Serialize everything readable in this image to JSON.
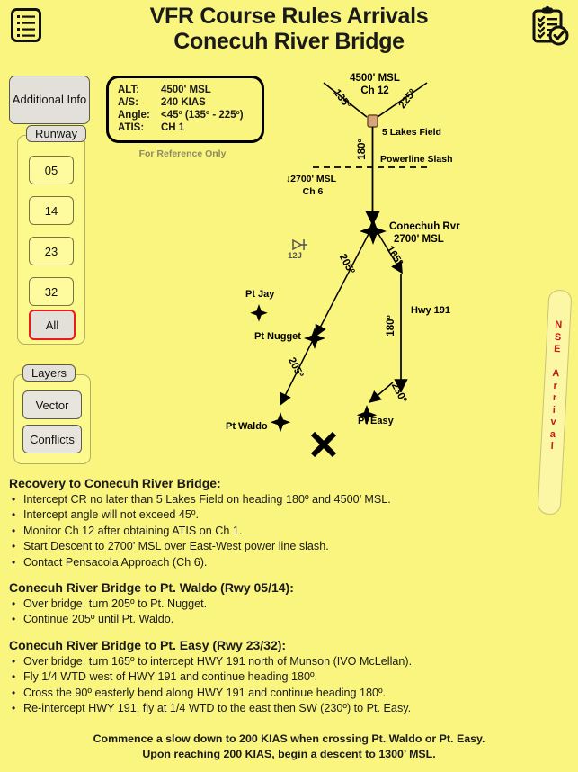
{
  "header": {
    "title_line1": "VFR Course Rules Arrivals",
    "title_line2": "Conecuh River Bridge",
    "notes_icon": "notes-list-icon",
    "checklist_icon": "clipboard-check-icon"
  },
  "controls": {
    "additional_info_label": "Additional Info",
    "runway": {
      "legend": "Runway",
      "buttons": [
        "05",
        "14",
        "23",
        "32",
        "All"
      ],
      "selected": "All",
      "selected_color": "#ee1b1b"
    },
    "layers": {
      "legend": "Layers",
      "buttons": [
        "Vector",
        "Conflicts"
      ]
    }
  },
  "reference_box": {
    "rows": [
      {
        "key": "ALT:",
        "value": "4500' MSL"
      },
      {
        "key": "A/S:",
        "value": "240 KIAS"
      },
      {
        "key": "Angle:",
        "value": "<45º (135º - 225º)"
      },
      {
        "key": "ATIS:",
        "value": "CH 1"
      }
    ],
    "note": "For Reference Only"
  },
  "side_tab": {
    "label": "NSE Arrival",
    "color": "#c41a1a"
  },
  "map": {
    "labels": {
      "top_alt": "4500' MSL",
      "top_ch": "Ch 12",
      "inbound_left": "135º",
      "inbound_right": "225º",
      "leg_180_top": "180º",
      "five_lakes": "5 Lakes Field",
      "powerline": "Powerline Slash",
      "descend_alt": "↓2700' MSL",
      "descend_ch": "Ch 6",
      "bridge_name": "Conechuh Rvr",
      "bridge_alt": "2700' MSL",
      "leg_205_a": "205º",
      "leg_165": "165º",
      "leg_180_hwy": "180º",
      "hwy": "Hwy 191",
      "leg_205_b": "205º",
      "leg_230": "230º",
      "airport_id": "12J",
      "pt_jay": "Pt Jay",
      "pt_nugget": "Pt Nugget",
      "pt_waldo": "Pt Waldo",
      "pt_easy": "Pt Easy"
    }
  },
  "sections": [
    {
      "heading": "Recovery to Conecuh River Bridge:",
      "bullets": [
        "Intercept CR no later than 5 Lakes Field on heading 180º and 4500’ MSL.",
        "Intercept angle will not exceed 45º.",
        "Monitor Ch 12 after obtaining ATIS on Ch 1.",
        "Start Descent to 2700’ MSL over East-West power line slash.",
        "Contact Pensacola Approach (Ch 6)."
      ]
    },
    {
      "heading": "Conecuh River Bridge to Pt. Waldo (Rwy 05/14):",
      "bullets": [
        "Over bridge, turn 205º to Pt. Nugget.",
        "Continue 205º until Pt. Waldo."
      ]
    },
    {
      "heading": "Conecuh River Bridge to Pt. Easy (Rwy 23/32):",
      "bullets": [
        "Over bridge, turn 165º to intercept HWY 191 north of Munson (IVO McLellan).",
        "Fly 1/4 WTD west of HWY 191 and continue heading 180º.",
        "Cross the 90º easterly bend along HWY 191 and continue heading 180º.",
        "Re-intercept HWY 191, fly at 1/4 WTD to the east then SW (230º) to Pt. Easy."
      ]
    }
  ],
  "footer": {
    "line1": "Commence a slow down to 200 KIAS when crossing Pt. Waldo or Pt. Easy.",
    "line2": "Upon reaching 200 KIAS, begin a descent to 1300’ MSL."
  }
}
